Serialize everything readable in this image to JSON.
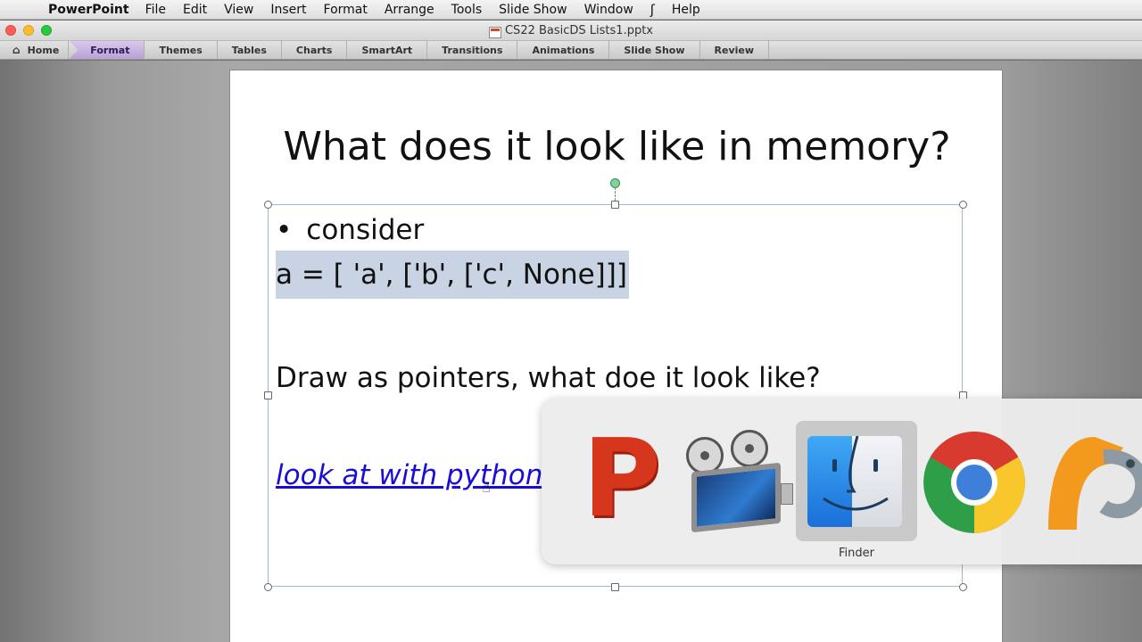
{
  "menubar": {
    "app_name": "PowerPoint",
    "items": [
      "File",
      "Edit",
      "View",
      "Insert",
      "Format",
      "Arrange",
      "Tools",
      "Slide Show",
      "Window",
      "Help"
    ],
    "script_icon": "script-icon",
    "apple_icon": "apple-icon"
  },
  "window": {
    "title": "CS22 BasicDS Lists1.pptx"
  },
  "ribbon": {
    "tabs": [
      "Home",
      "Format",
      "Themes",
      "Tables",
      "Charts",
      "SmartArt",
      "Transitions",
      "Animations",
      "Slide Show",
      "Review"
    ],
    "active_tab": "Format",
    "active_color": "#b8a1d8"
  },
  "slide": {
    "title": "What does it look like in memory?",
    "bullet_marker": "•",
    "bullet_text": "consider",
    "code_text": "a = [ 'a', ['b', ['c', None]]]",
    "question_text": "Draw as pointers, what doe it look like?",
    "link_text": "look at with python",
    "link_color": "#1a0dd6",
    "selection_highlight": "#c8d3e3"
  },
  "app_switcher": {
    "apps": [
      "powerpoint-icon",
      "screen-recorder-icon",
      "finder-icon",
      "chrome-icon",
      "pycharm-icon"
    ],
    "selected_label": "Finder"
  }
}
